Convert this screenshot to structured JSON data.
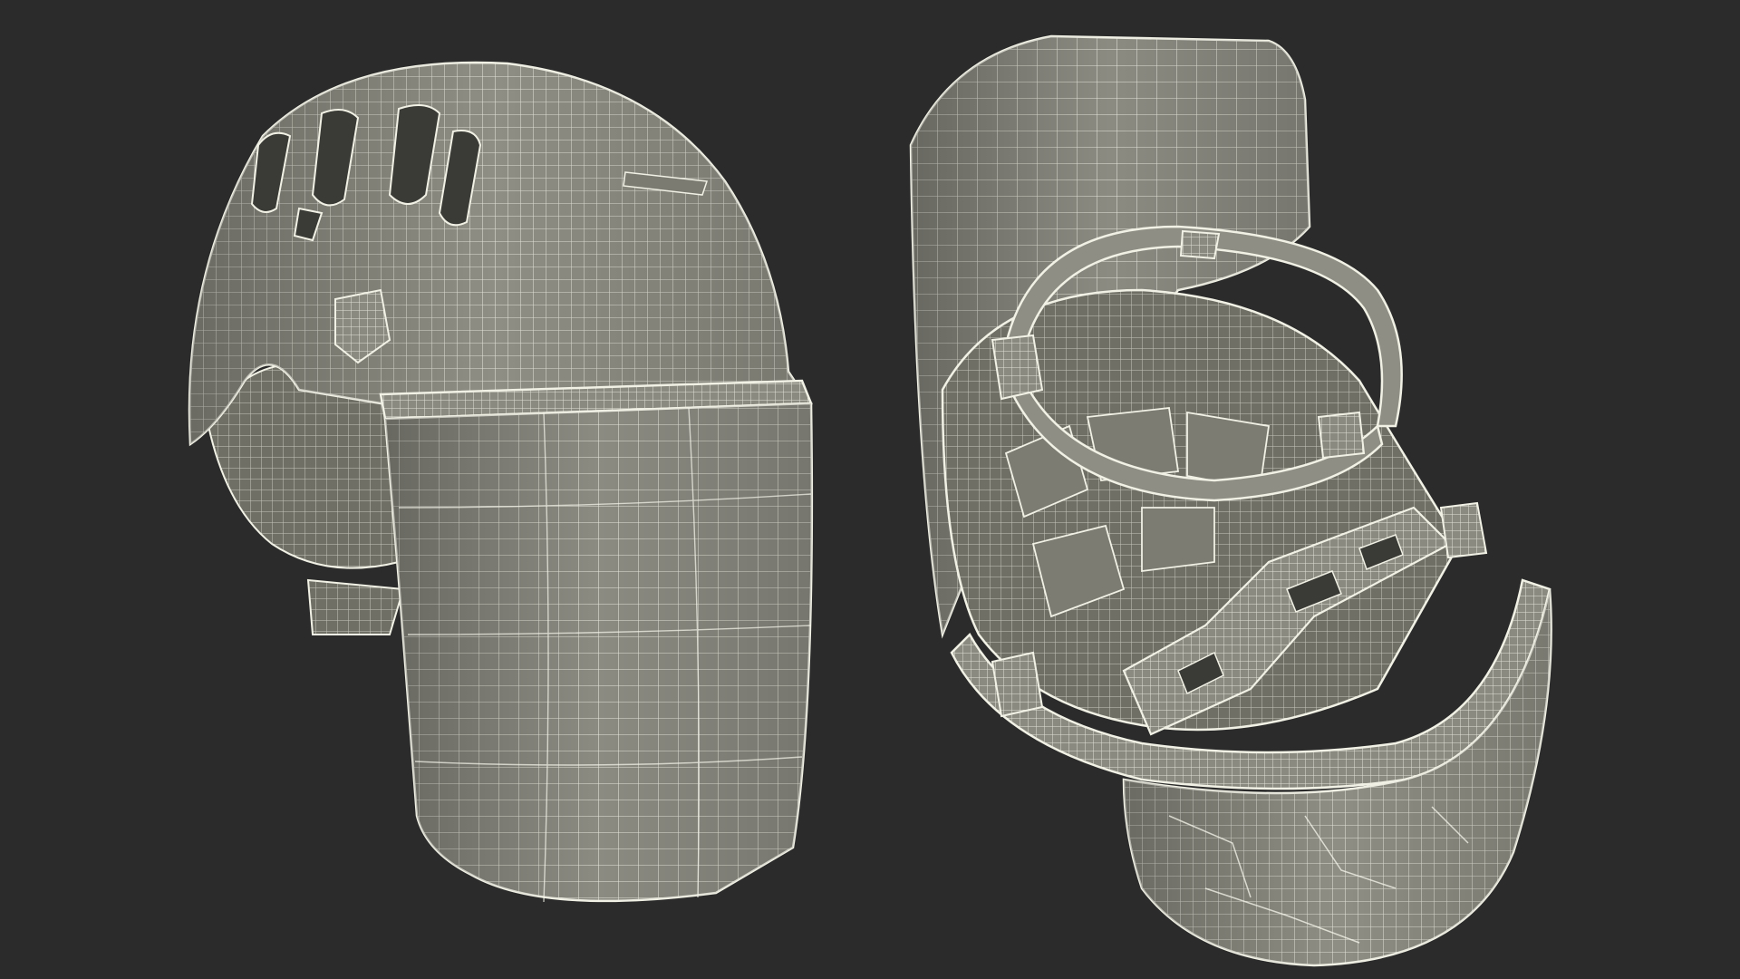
{
  "scene": {
    "description_free": true,
    "background_color": "#2b2b2b",
    "mesh_fill_color": "#8e8e84",
    "mesh_shadow_color": "#6b6b62",
    "wire_color": "#f1f1e6"
  }
}
